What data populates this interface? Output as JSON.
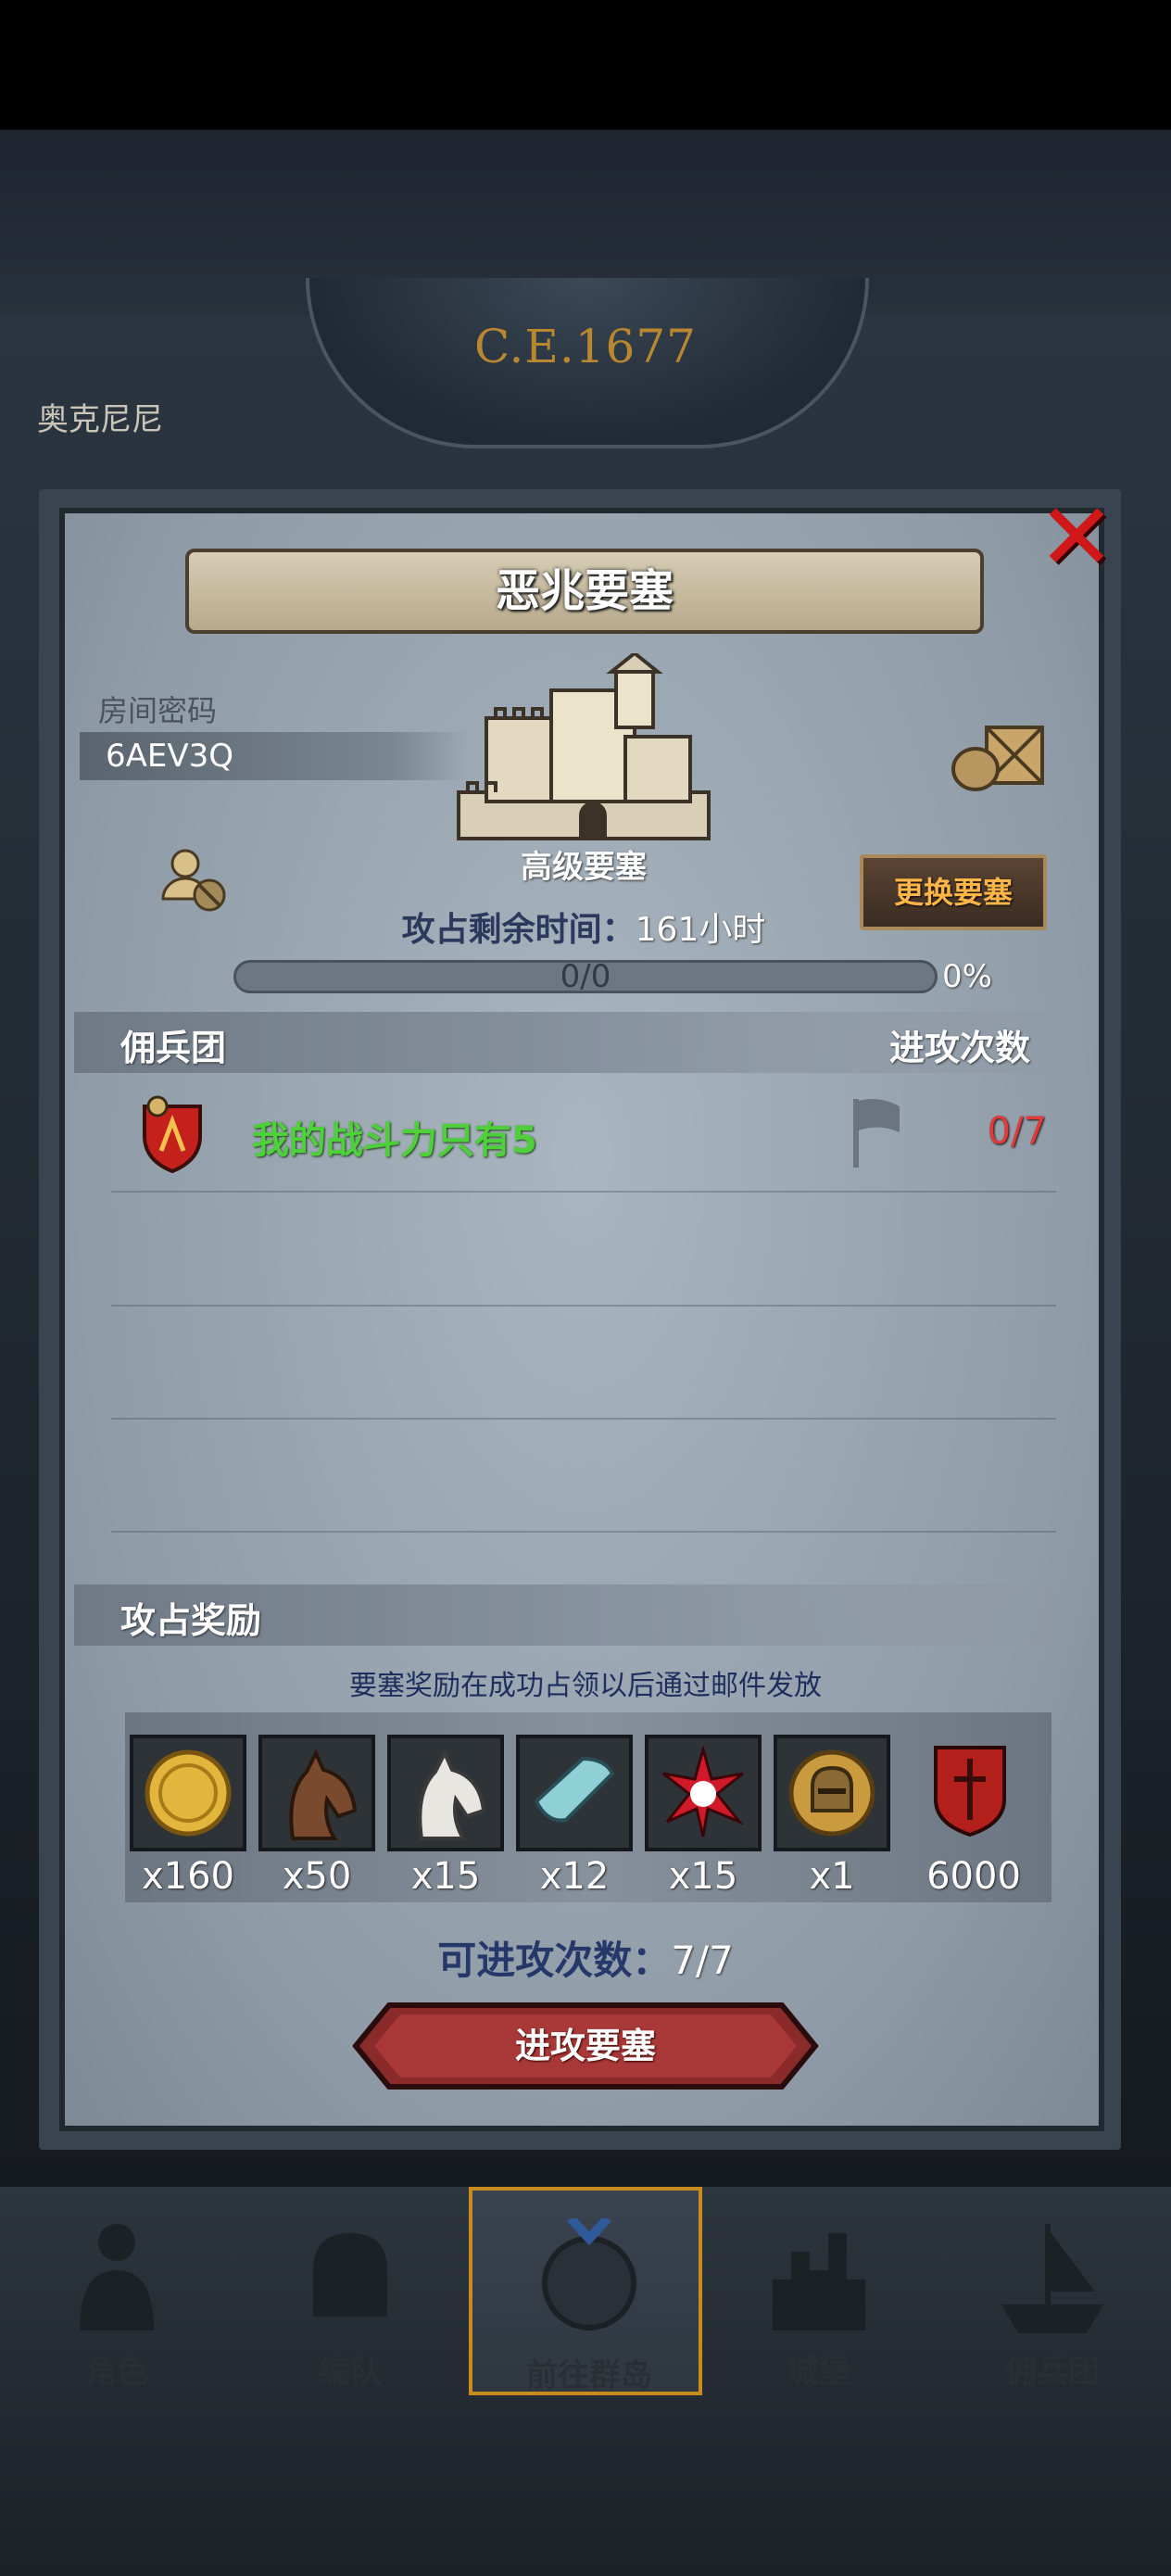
{
  "header": {
    "era": "C.E.1677",
    "location": "奥克尼尼"
  },
  "dialog": {
    "title": "恶兆要塞",
    "room_label": "房间密码",
    "room_code": "6AEV3Q",
    "fortress_name": "高级要塞",
    "swap_label": "更换要塞",
    "time_prefix": "攻占剩余时间：",
    "time_value": "161小时",
    "progress_text": "0/0",
    "progress_percent": "0%",
    "progress_fraction": 0,
    "mercenary_header": "佣兵团",
    "attack_count_header": "进攻次数",
    "guild": {
      "name": "我的战斗力只有5",
      "attacks": "0/7"
    },
    "reward_header": "攻占奖励",
    "reward_note": "要塞奖励在成功占领以后通过邮件发放",
    "rewards": [
      {
        "icon": "gold-coin-icon",
        "qty": "x160"
      },
      {
        "icon": "brown-horse-icon",
        "qty": "x50"
      },
      {
        "icon": "white-horse-icon",
        "qty": "x15"
      },
      {
        "icon": "cloth-roll-icon",
        "qty": "x12"
      },
      {
        "icon": "red-crystal-icon",
        "qty": "x15"
      },
      {
        "icon": "knight-helmet-coin-icon",
        "qty": "x1"
      },
      {
        "icon": "guild-banner-icon",
        "qty": "6000"
      }
    ],
    "can_attack_label": "可进攻次数：",
    "can_attack_value": "7/7",
    "attack_button": "进攻要塞"
  },
  "nav": {
    "items": [
      "角色",
      "编队",
      "前往群岛",
      "城堡",
      "佣兵团"
    ],
    "active": "前往群岛"
  },
  "colors": {
    "guild_name": "#4ed03a",
    "attack_count": "#e03a3a",
    "accent": "#ffb548",
    "close": "#d01818"
  }
}
